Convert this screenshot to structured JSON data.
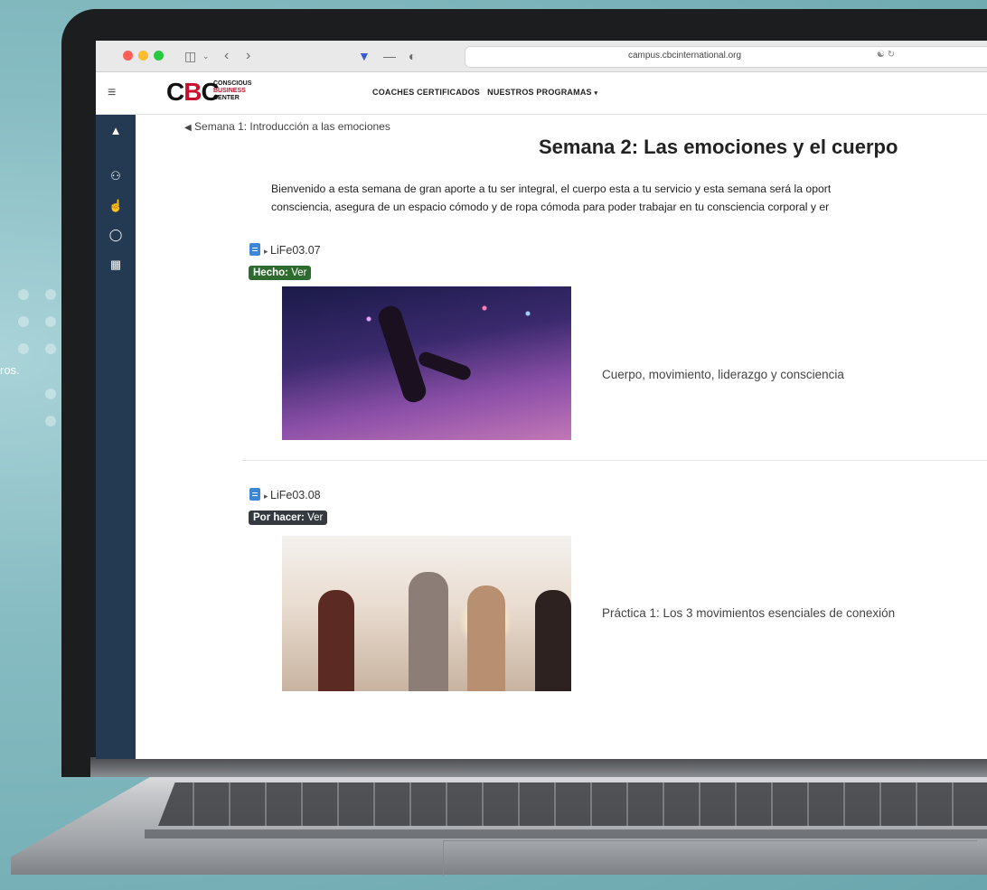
{
  "background": {
    "partial_text": "ros."
  },
  "browser": {
    "url": "campus.cbcinternational.org"
  },
  "site": {
    "logo_text": "CBC",
    "logo_sub": [
      "CONSCIOUS",
      "BUSINESS",
      "CENTER"
    ],
    "menu": [
      "COACHES CERTIFICADOS",
      "NUESTROS PROGRAMAS"
    ]
  },
  "sidebar": {
    "icons": [
      "graduation-cap-icon",
      "users-icon",
      "thumbs-up-icon",
      "compass-icon",
      "calendar-icon"
    ]
  },
  "page": {
    "prev_link": "Semana 1: Introducción a las emociones",
    "title": "Semana 2: Las emociones y el cuerpo",
    "intro_lines": [
      "Bienvenido a esta semana de gran aporte a tu ser integral, el cuerpo esta a tu servicio y esta semana será la oport",
      "consciencia, asegura de un espacio cómodo y de ropa cómoda para poder trabajar en tu consciencia corporal y er"
    ]
  },
  "items": [
    {
      "code": "LiFe03.07",
      "status_label": "Hecho:",
      "status_action": "Ver",
      "status_color": "#2e6b2f",
      "caption": "Cuerpo, movimiento, liderazgo y consciencia"
    },
    {
      "code": "LiFe03.08",
      "status_label": "Por hacer:",
      "status_action": "Ver",
      "status_color": "#343a40",
      "caption": "Práctica 1: Los 3 movimientos esenciales de conexión"
    }
  ]
}
